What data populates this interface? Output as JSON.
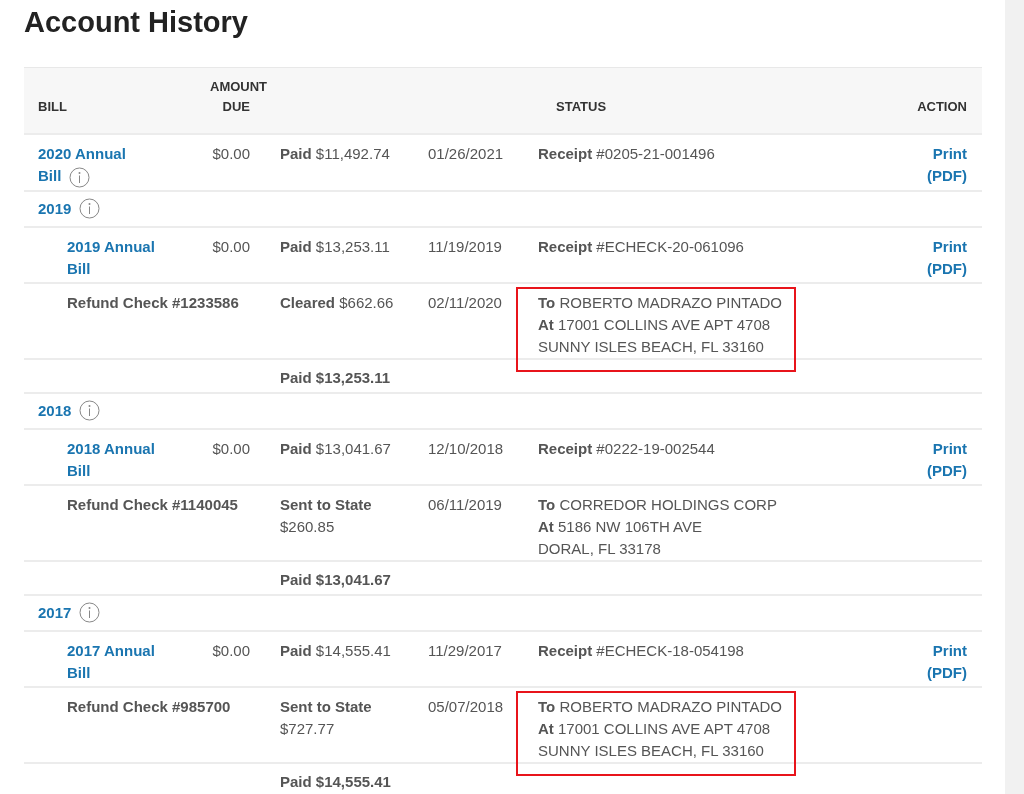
{
  "title": "Account History",
  "columns": {
    "bill": "BILL",
    "amount_due": "AMOUNT DUE",
    "status": "STATUS",
    "action": "ACTION"
  },
  "rows": [
    {
      "kind": "bill",
      "nested": false,
      "bill": "2020 Annual Bill",
      "info": true,
      "amount_due": "$0.00",
      "status": "**Paid** $11,492.74",
      "date": "01/26/2021",
      "detail": [
        "**Receipt** #0205-21-001496"
      ],
      "action": "Print (PDF)"
    },
    {
      "kind": "group",
      "year": "2019"
    },
    {
      "kind": "bill",
      "nested": true,
      "bill": "2019 Annual Bill",
      "info": false,
      "amount_due": "$0.00",
      "status": "**Paid** $13,253.11",
      "date": "11/19/2019",
      "detail": [
        "**Receipt** #ECHECK-20-061096"
      ],
      "action": "Print (PDF)"
    },
    {
      "kind": "refund",
      "label": "Refund Check #1233586",
      "status": "**Cleared** $662.66",
      "date": "02/11/2020",
      "detail": [
        "**To** ROBERTO MADRAZO PINTADO",
        "**At** 17001 COLLINS AVE APT 4708",
        "SUNNY ISLES BEACH, FL 33160"
      ],
      "highlighted": true
    },
    {
      "kind": "total",
      "status": "Paid $13,253.11"
    },
    {
      "kind": "group",
      "year": "2018"
    },
    {
      "kind": "bill",
      "nested": true,
      "bill": "2018 Annual Bill",
      "info": false,
      "amount_due": "$0.00",
      "status": "**Paid** $13,041.67",
      "date": "12/10/2018",
      "detail": [
        "**Receipt** #0222-19-002544"
      ],
      "action": "Print (PDF)"
    },
    {
      "kind": "refund",
      "label": "Refund Check #1140045",
      "status": "**Sent to State** $260.85",
      "date": "06/11/2019",
      "detail": [
        "**To** CORREDOR HOLDINGS CORP",
        "**At** 5186 NW 106TH AVE",
        "DORAL, FL 33178"
      ],
      "highlighted": false
    },
    {
      "kind": "total",
      "status": "Paid $13,041.67"
    },
    {
      "kind": "group",
      "year": "2017"
    },
    {
      "kind": "bill",
      "nested": true,
      "bill": "2017 Annual Bill",
      "info": false,
      "amount_due": "$0.00",
      "status": "**Paid** $14,555.41",
      "date": "11/29/2017",
      "detail": [
        "**Receipt** #ECHECK-18-054198"
      ],
      "action": "Print (PDF)"
    },
    {
      "kind": "refund",
      "label": "Refund Check #985700",
      "status": "**Sent to State** $727.77",
      "date": "05/07/2018",
      "detail": [
        "**To** ROBERTO MADRAZO PINTADO",
        "**At** 17001 COLLINS AVE APT 4708",
        "SUNNY ISLES BEACH, FL 33160"
      ],
      "highlighted": true
    },
    {
      "kind": "total",
      "status": "Paid $14,555.41"
    }
  ]
}
